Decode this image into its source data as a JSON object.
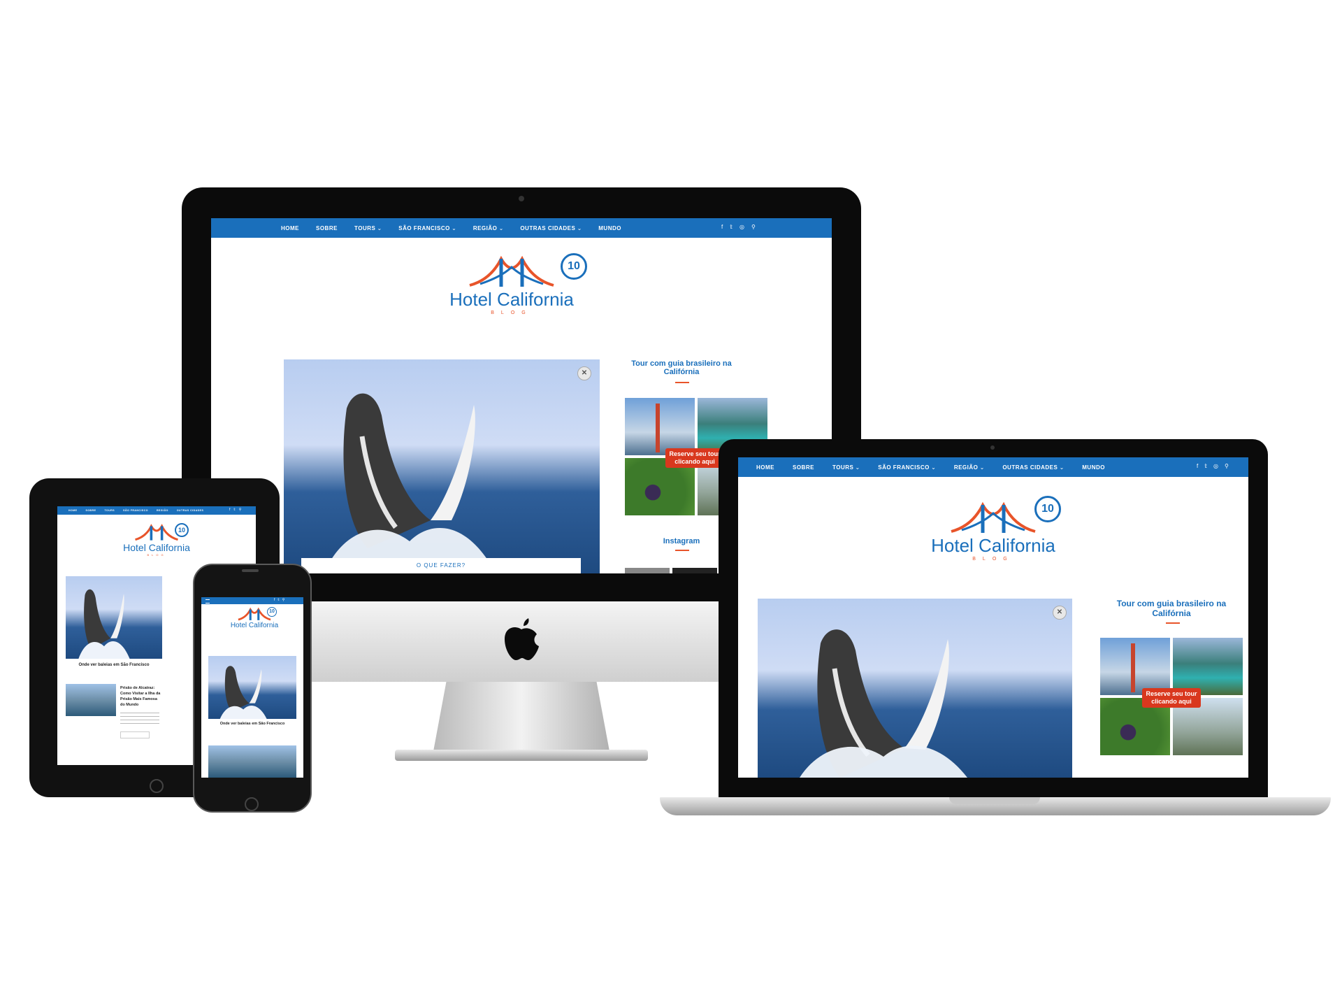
{
  "nav": {
    "items": [
      "HOME",
      "SOBRE",
      "TOURS",
      "SÃO FRANCISCO",
      "REGIÃO",
      "OUTRAS CIDADES",
      "MUNDO"
    ],
    "tablet_items": [
      "HOME",
      "SOBRE",
      "TOURS",
      "SÃO FRANCISCO",
      "REGIÃO",
      "OUTRAS CIDADES"
    ],
    "dropdown_glyph": "⌄",
    "facebook": "f",
    "twitter": "𝕥",
    "instagram": "◎",
    "search": "⚲"
  },
  "logo": {
    "title": "Hotel California",
    "subtitle": "BLOG",
    "badge": "10"
  },
  "hero": {
    "close": "✕",
    "category": "O QUE FAZER?"
  },
  "sidebar": {
    "tour_title": "Tour com guia brasileiro na Califórnia",
    "cta": "Reserve seu tour clicando aqui",
    "instagram_title": "Instagram"
  },
  "posts": {
    "featured_title": "Onde ver baleias em São Francisco",
    "second_title": "Prisão de Alcatraz: Como Visitar a Ilha da Prisão Mais Famosa do Mundo"
  },
  "colors": {
    "brand_blue": "#1a6fbb",
    "accent_orange": "#e8542a",
    "cta_red": "#d9381e"
  }
}
